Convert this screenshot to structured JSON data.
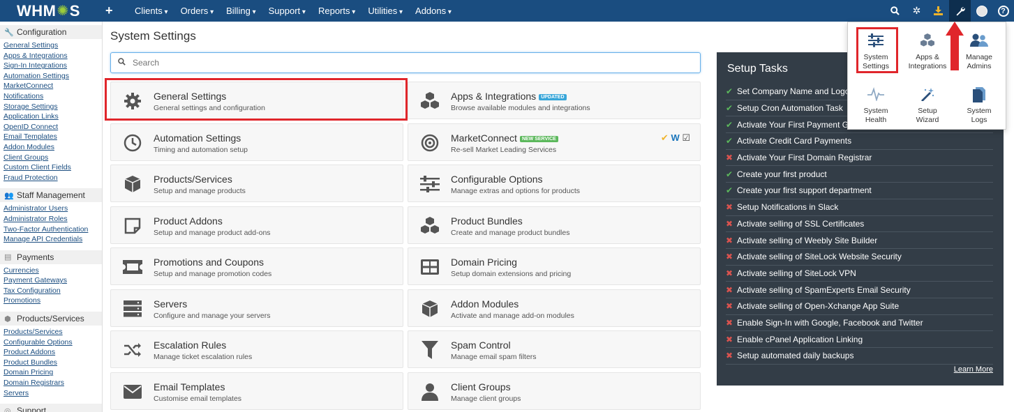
{
  "navbar": {
    "logo_pre": "WHM",
    "logo_post": "S",
    "plus": "+",
    "menu": [
      "Clients",
      "Orders",
      "Billing",
      "Support",
      "Reports",
      "Utilities",
      "Addons"
    ]
  },
  "sidebar": {
    "sections": [
      {
        "title": "Configuration",
        "icon": "wrench-icon",
        "items": [
          "General Settings",
          "Apps & Integrations",
          "Sign-In Integrations",
          "Automation Settings",
          "MarketConnect",
          "Notifications",
          "Storage Settings",
          "Application Links",
          "OpenID Connect",
          "Email Templates",
          "Addon Modules",
          "Client Groups",
          "Custom Client Fields",
          "Fraud Protection"
        ]
      },
      {
        "title": "Staff Management",
        "icon": "users-icon",
        "items": [
          "Administrator Users",
          "Administrator Roles",
          "Two-Factor Authentication",
          "Manage API Credentials"
        ]
      },
      {
        "title": "Payments",
        "icon": "money-icon",
        "items": [
          "Currencies",
          "Payment Gateways",
          "Tax Configuration",
          "Promotions"
        ]
      },
      {
        "title": "Products/Services",
        "icon": "cubes-icon",
        "items": [
          "Products/Services",
          "Configurable Options",
          "Product Addons",
          "Product Bundles",
          "Domain Pricing",
          "Domain Registrars",
          "Servers"
        ]
      },
      {
        "title": "Support",
        "icon": "life-ring-icon",
        "items": []
      }
    ]
  },
  "main": {
    "title": "System Settings",
    "search_placeholder": "Search",
    "tiles": [
      {
        "title": "General Settings",
        "sub": "General settings and configuration",
        "icon": "gear-icon"
      },
      {
        "title": "Apps & Integrations",
        "sub": "Browse available modules and integrations",
        "icon": "cubes-icon",
        "badge": "UPDATED"
      },
      {
        "title": "Automation Settings",
        "sub": "Timing and automation setup",
        "icon": "clock-icon"
      },
      {
        "title": "MarketConnect",
        "sub": "Re-sell Market Leading Services",
        "icon": "target-icon",
        "badge": "NEW SERVICE"
      },
      {
        "title": "Products/Services",
        "sub": "Setup and manage products",
        "icon": "cube-icon"
      },
      {
        "title": "Configurable Options",
        "sub": "Manage extras and options for products",
        "icon": "sliders-icon"
      },
      {
        "title": "Product Addons",
        "sub": "Setup and manage product add-ons",
        "icon": "sticky-note-icon"
      },
      {
        "title": "Product Bundles",
        "sub": "Create and manage product bundles",
        "icon": "cubes-icon"
      },
      {
        "title": "Promotions and Coupons",
        "sub": "Setup and manage promotion codes",
        "icon": "ticket-icon"
      },
      {
        "title": "Domain Pricing",
        "sub": "Setup domain extensions and pricing",
        "icon": "grid-icon"
      },
      {
        "title": "Servers",
        "sub": "Configure and manage your servers",
        "icon": "server-icon"
      },
      {
        "title": "Addon Modules",
        "sub": "Activate and manage add-on modules",
        "icon": "cube-icon"
      },
      {
        "title": "Escalation Rules",
        "sub": "Manage ticket escalation rules",
        "icon": "random-icon"
      },
      {
        "title": "Spam Control",
        "sub": "Manage email spam filters",
        "icon": "filter-icon"
      },
      {
        "title": "Email Templates",
        "sub": "Customise email templates",
        "icon": "envelope-icon"
      },
      {
        "title": "Client Groups",
        "sub": "Manage client groups",
        "icon": "user-icon"
      }
    ]
  },
  "setup": {
    "title": "Setup Tasks",
    "learn_more": "Learn More",
    "tasks": [
      {
        "label": "Set Company Name and Logo",
        "done": true
      },
      {
        "label": "Setup Cron Automation Task",
        "done": true
      },
      {
        "label": "Activate Your First Payment Gateway",
        "done": true
      },
      {
        "label": "Activate Credit Card Payments",
        "done": true
      },
      {
        "label": "Activate Your First Domain Registrar",
        "done": false
      },
      {
        "label": "Create your first product",
        "done": true
      },
      {
        "label": "Create your first support department",
        "done": true
      },
      {
        "label": "Setup Notifications in Slack",
        "done": false
      },
      {
        "label": "Activate selling of SSL Certificates",
        "done": false
      },
      {
        "label": "Activate selling of Weebly Site Builder",
        "done": false
      },
      {
        "label": "Activate selling of SiteLock Website Security",
        "done": false
      },
      {
        "label": "Activate selling of SiteLock VPN",
        "done": false
      },
      {
        "label": "Activate selling of SpamExperts Email Security",
        "done": false
      },
      {
        "label": "Activate selling of Open-Xchange App Suite",
        "done": false
      },
      {
        "label": "Enable Sign-In with Google, Facebook and Twitter",
        "done": false
      },
      {
        "label": "Enable cPanel Application Linking",
        "done": false
      },
      {
        "label": "Setup automated daily backups",
        "done": false
      }
    ]
  },
  "dropdown": {
    "items": [
      {
        "l1": "System",
        "l2": "Settings",
        "icon": "sliders-icon"
      },
      {
        "l1": "Apps &",
        "l2": "Integrations",
        "icon": "cubes-icon"
      },
      {
        "l1": "Manage",
        "l2": "Admins",
        "icon": "users-icon"
      },
      {
        "l1": "System",
        "l2": "Health",
        "icon": "heartbeat-icon"
      },
      {
        "l1": "Setup",
        "l2": "Wizard",
        "icon": "magic-icon"
      },
      {
        "l1": "System",
        "l2": "Logs",
        "icon": "file-icon"
      }
    ]
  }
}
